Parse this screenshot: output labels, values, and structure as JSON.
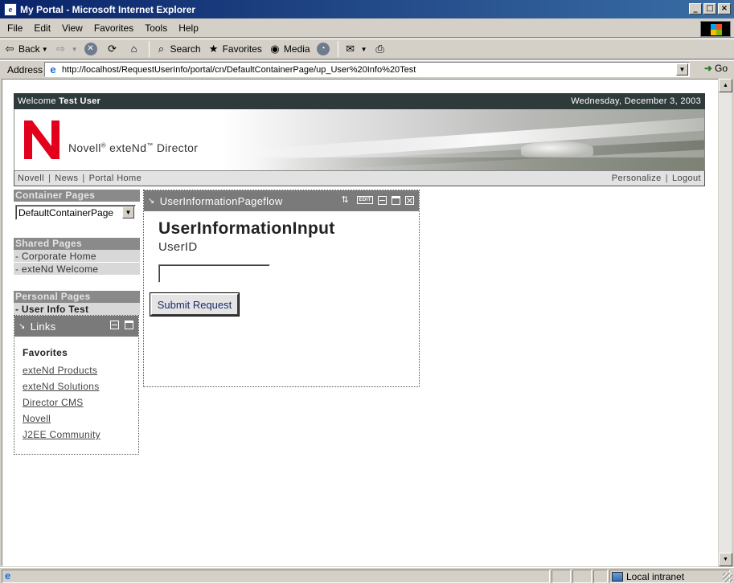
{
  "window": {
    "title": "My Portal - Microsoft Internet Explorer"
  },
  "menu": [
    "File",
    "Edit",
    "View",
    "Favorites",
    "Tools",
    "Help"
  ],
  "toolbar": {
    "back": "Back",
    "search": "Search",
    "favorites": "Favorites",
    "media": "Media"
  },
  "address": {
    "label": "Address",
    "url": "http://localhost/RequestUserInfo/portal/cn/DefaultContainerPage/up_User%20Info%20Test",
    "go": "Go"
  },
  "portal": {
    "welcome_prefix": "Welcome",
    "user": "Test User",
    "date": "Wednesday, December 3, 2003",
    "brand_a": "Novell",
    "brand_b": "exteNd",
    "brand_c": "Director",
    "nav_left": [
      "Novell",
      "News",
      "Portal Home"
    ],
    "nav_right": [
      "Personalize",
      "Logout"
    ]
  },
  "left": {
    "container_header": "Container Pages",
    "container_selected": "DefaultContainerPage",
    "shared_header": "Shared Pages",
    "shared_items": [
      "- Corporate Home",
      "- exteNd Welcome"
    ],
    "personal_header": "Personal Pages",
    "personal_items": [
      "- User Info Test"
    ],
    "links_title": "Links",
    "links_heading": "Favorites",
    "links": [
      "exteNd Products",
      "exteNd Solutions",
      "Director CMS",
      "Novell",
      "J2EE Community"
    ]
  },
  "main": {
    "portlet_title": "UserInformationPageflow",
    "edit_label": "EDIT",
    "form_title": "UserInformationInput",
    "field_label": "UserID",
    "field_value": "",
    "submit_label": "Submit Request"
  },
  "status": {
    "zone": "Local intranet"
  }
}
